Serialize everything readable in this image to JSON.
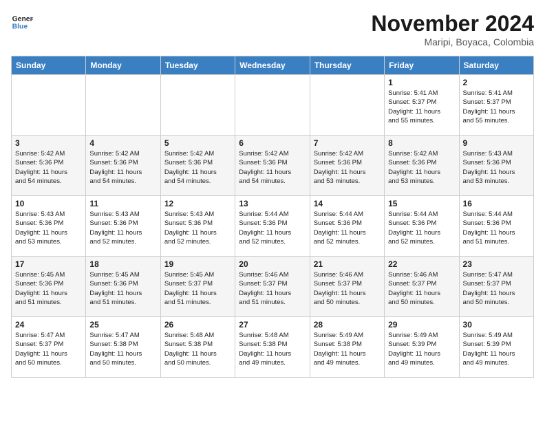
{
  "header": {
    "logo_line1": "General",
    "logo_line2": "Blue",
    "month": "November 2024",
    "location": "Maripi, Boyaca, Colombia"
  },
  "weekdays": [
    "Sunday",
    "Monday",
    "Tuesday",
    "Wednesday",
    "Thursday",
    "Friday",
    "Saturday"
  ],
  "weeks": [
    [
      {
        "day": "",
        "info": ""
      },
      {
        "day": "",
        "info": ""
      },
      {
        "day": "",
        "info": ""
      },
      {
        "day": "",
        "info": ""
      },
      {
        "day": "",
        "info": ""
      },
      {
        "day": "1",
        "info": "Sunrise: 5:41 AM\nSunset: 5:37 PM\nDaylight: 11 hours\nand 55 minutes."
      },
      {
        "day": "2",
        "info": "Sunrise: 5:41 AM\nSunset: 5:37 PM\nDaylight: 11 hours\nand 55 minutes."
      }
    ],
    [
      {
        "day": "3",
        "info": "Sunrise: 5:42 AM\nSunset: 5:36 PM\nDaylight: 11 hours\nand 54 minutes."
      },
      {
        "day": "4",
        "info": "Sunrise: 5:42 AM\nSunset: 5:36 PM\nDaylight: 11 hours\nand 54 minutes."
      },
      {
        "day": "5",
        "info": "Sunrise: 5:42 AM\nSunset: 5:36 PM\nDaylight: 11 hours\nand 54 minutes."
      },
      {
        "day": "6",
        "info": "Sunrise: 5:42 AM\nSunset: 5:36 PM\nDaylight: 11 hours\nand 54 minutes."
      },
      {
        "day": "7",
        "info": "Sunrise: 5:42 AM\nSunset: 5:36 PM\nDaylight: 11 hours\nand 53 minutes."
      },
      {
        "day": "8",
        "info": "Sunrise: 5:42 AM\nSunset: 5:36 PM\nDaylight: 11 hours\nand 53 minutes."
      },
      {
        "day": "9",
        "info": "Sunrise: 5:43 AM\nSunset: 5:36 PM\nDaylight: 11 hours\nand 53 minutes."
      }
    ],
    [
      {
        "day": "10",
        "info": "Sunrise: 5:43 AM\nSunset: 5:36 PM\nDaylight: 11 hours\nand 53 minutes."
      },
      {
        "day": "11",
        "info": "Sunrise: 5:43 AM\nSunset: 5:36 PM\nDaylight: 11 hours\nand 52 minutes."
      },
      {
        "day": "12",
        "info": "Sunrise: 5:43 AM\nSunset: 5:36 PM\nDaylight: 11 hours\nand 52 minutes."
      },
      {
        "day": "13",
        "info": "Sunrise: 5:44 AM\nSunset: 5:36 PM\nDaylight: 11 hours\nand 52 minutes."
      },
      {
        "day": "14",
        "info": "Sunrise: 5:44 AM\nSunset: 5:36 PM\nDaylight: 11 hours\nand 52 minutes."
      },
      {
        "day": "15",
        "info": "Sunrise: 5:44 AM\nSunset: 5:36 PM\nDaylight: 11 hours\nand 52 minutes."
      },
      {
        "day": "16",
        "info": "Sunrise: 5:44 AM\nSunset: 5:36 PM\nDaylight: 11 hours\nand 51 minutes."
      }
    ],
    [
      {
        "day": "17",
        "info": "Sunrise: 5:45 AM\nSunset: 5:36 PM\nDaylight: 11 hours\nand 51 minutes."
      },
      {
        "day": "18",
        "info": "Sunrise: 5:45 AM\nSunset: 5:36 PM\nDaylight: 11 hours\nand 51 minutes."
      },
      {
        "day": "19",
        "info": "Sunrise: 5:45 AM\nSunset: 5:37 PM\nDaylight: 11 hours\nand 51 minutes."
      },
      {
        "day": "20",
        "info": "Sunrise: 5:46 AM\nSunset: 5:37 PM\nDaylight: 11 hours\nand 51 minutes."
      },
      {
        "day": "21",
        "info": "Sunrise: 5:46 AM\nSunset: 5:37 PM\nDaylight: 11 hours\nand 50 minutes."
      },
      {
        "day": "22",
        "info": "Sunrise: 5:46 AM\nSunset: 5:37 PM\nDaylight: 11 hours\nand 50 minutes."
      },
      {
        "day": "23",
        "info": "Sunrise: 5:47 AM\nSunset: 5:37 PM\nDaylight: 11 hours\nand 50 minutes."
      }
    ],
    [
      {
        "day": "24",
        "info": "Sunrise: 5:47 AM\nSunset: 5:37 PM\nDaylight: 11 hours\nand 50 minutes."
      },
      {
        "day": "25",
        "info": "Sunrise: 5:47 AM\nSunset: 5:38 PM\nDaylight: 11 hours\nand 50 minutes."
      },
      {
        "day": "26",
        "info": "Sunrise: 5:48 AM\nSunset: 5:38 PM\nDaylight: 11 hours\nand 50 minutes."
      },
      {
        "day": "27",
        "info": "Sunrise: 5:48 AM\nSunset: 5:38 PM\nDaylight: 11 hours\nand 49 minutes."
      },
      {
        "day": "28",
        "info": "Sunrise: 5:49 AM\nSunset: 5:38 PM\nDaylight: 11 hours\nand 49 minutes."
      },
      {
        "day": "29",
        "info": "Sunrise: 5:49 AM\nSunset: 5:39 PM\nDaylight: 11 hours\nand 49 minutes."
      },
      {
        "day": "30",
        "info": "Sunrise: 5:49 AM\nSunset: 5:39 PM\nDaylight: 11 hours\nand 49 minutes."
      }
    ]
  ]
}
